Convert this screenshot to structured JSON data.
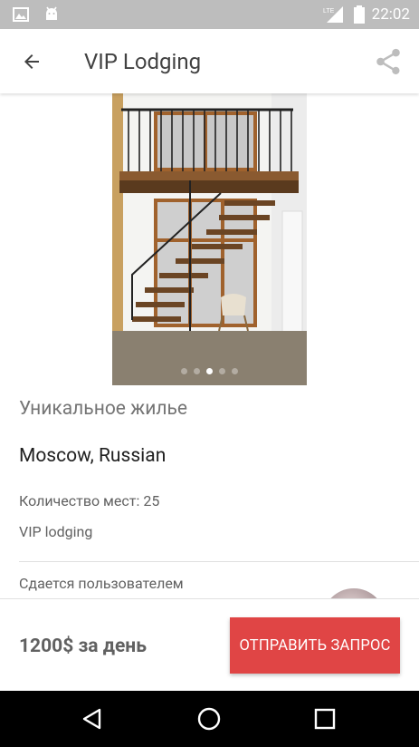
{
  "status_bar": {
    "time": "22:02",
    "network": "LTE",
    "left_icons": [
      "image-icon",
      "android-icon"
    ],
    "right_icons": [
      "signal-icon",
      "battery-icon"
    ]
  },
  "app_bar": {
    "title": "VIP Lodging",
    "back_icon": "arrow-back-icon",
    "share_icon": "share-icon"
  },
  "gallery": {
    "page_count": 5,
    "active_page": 3
  },
  "listing": {
    "title": "Уникальное жилье",
    "location": "Moscow, Russian",
    "places": "Количество мест: 25",
    "type": "VIP lodging",
    "owner_label": "Сдается пользователем"
  },
  "footer": {
    "price": "1200$ за день",
    "request_button": "ОТПРАВИТЬ ЗАПРОС"
  },
  "colors": {
    "accent": "#e04545",
    "status_bar": "#bdbdbd",
    "nav_bar": "#000000"
  },
  "nav_bar": {
    "icons": [
      "nav-back-icon",
      "nav-home-icon",
      "nav-recents-icon"
    ]
  }
}
